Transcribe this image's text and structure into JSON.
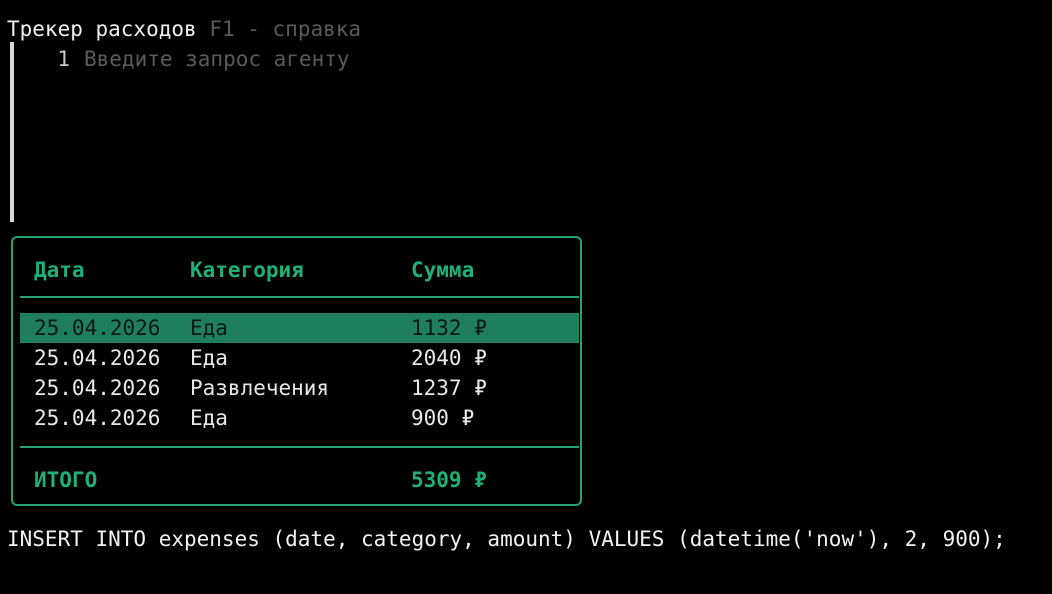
{
  "title": {
    "app_name": "Трекер расходов",
    "hint": "F1 - справка"
  },
  "editor": {
    "line_number": "1",
    "placeholder": "Введите запрос агенту"
  },
  "table": {
    "columns": [
      "Дата",
      "Категория",
      "Сумма"
    ],
    "rows": [
      {
        "date": "25.04.2026",
        "category": "Еда",
        "amount": "1132 ₽"
      },
      {
        "date": "25.04.2026",
        "category": "Еда",
        "amount": "2040 ₽"
      },
      {
        "date": "25.04.2026",
        "category": "Развлечения",
        "amount": "1237 ₽"
      },
      {
        "date": "25.04.2026",
        "category": "Еда",
        "amount": "900 ₽"
      }
    ],
    "selected_row": 0,
    "total_label": "ИТОГО",
    "total_value": "5309 ₽"
  },
  "sql": "INSERT INTO expenses (date, category, amount) VALUES (datetime('now'), 2, 900);",
  "colors": {
    "accent": "#1fb077",
    "selection": "#1e7e5e",
    "background": "#000000"
  }
}
